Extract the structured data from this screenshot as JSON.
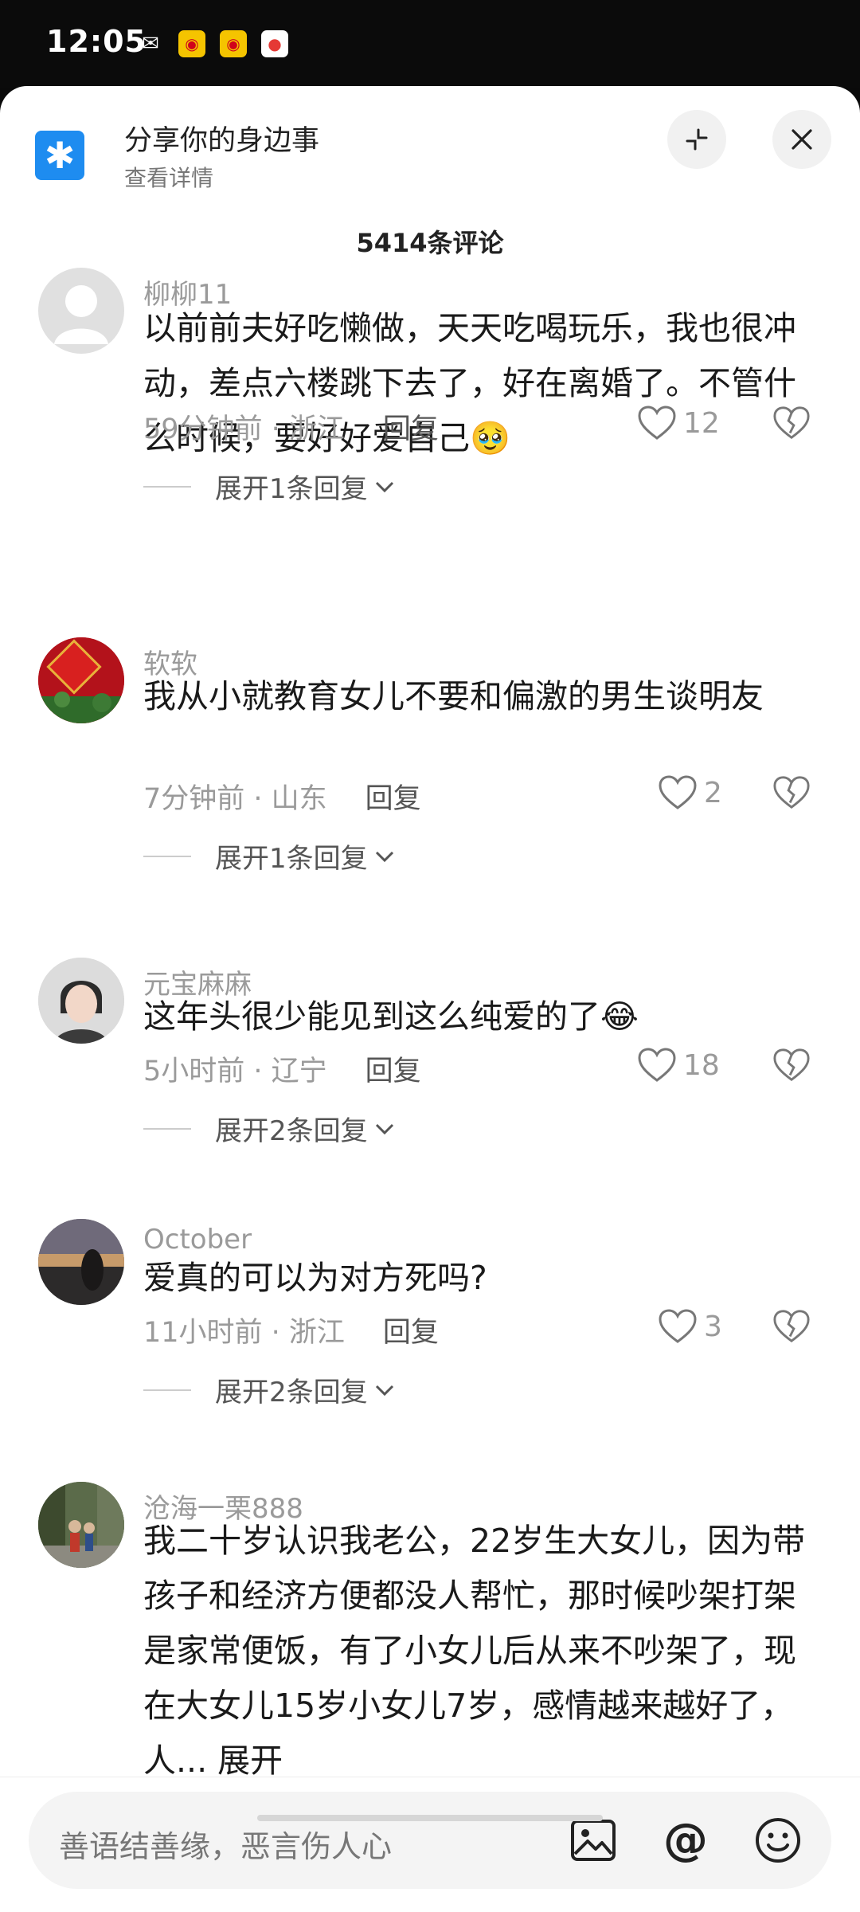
{
  "status_bar": {
    "time": "12:05",
    "icons": [
      "wechat-icon",
      "weibo-icon",
      "weibo-icon",
      "map-icon"
    ]
  },
  "header": {
    "title": "分享你的身边事",
    "subtitle": "查看详情"
  },
  "comment_count": "5414条评论",
  "comments": [
    {
      "username": "柳柳11",
      "text": "以前前夫好吃懒做，天天吃喝玩乐，我也很冲动，差点六楼跳下去了，好在离婚了。不管什么时候，要好好爱自己🥹",
      "meta": "59分钟前 · 浙江",
      "reply": "回复",
      "likes": "12",
      "expand": "展开1条回复"
    },
    {
      "username": "软软",
      "text": "我从小就教育女儿不要和偏激的男生谈明友",
      "meta": "7分钟前 · 山东",
      "reply": "回复",
      "likes": "2",
      "expand": "展开1条回复"
    },
    {
      "username": "元宝麻麻",
      "text": "这年头很少能见到这么纯爱的了😂",
      "meta": "5小时前 · 辽宁",
      "reply": "回复",
      "likes": "18",
      "expand": "展开2条回复"
    },
    {
      "username": "October",
      "text": "爱真的可以为对方死吗?",
      "meta": "11小时前 · 浙江",
      "reply": "回复",
      "likes": "3",
      "expand": "展开2条回复"
    },
    {
      "username": "沧海一栗888",
      "text": "我二十岁认识我老公，22岁生大女儿，因为带孩子和经济方便都没人帮忙，那时候吵架打架是家常便饭，有了小女儿后从来不吵架了，现在大女儿15岁小女儿7岁，感情越来越好了，人... 展开"
    }
  ],
  "input": {
    "placeholder": "善语结善缘，恶言伤人心"
  }
}
